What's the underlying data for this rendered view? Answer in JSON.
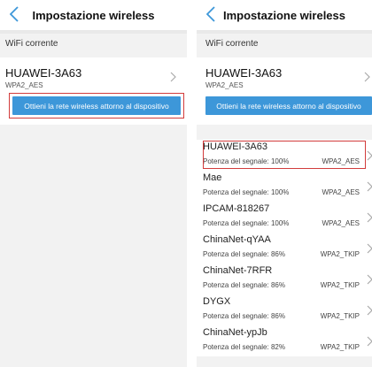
{
  "screen_left": {
    "header": {
      "title": "Impostazione wireless",
      "back_icon": "chevron-left-icon"
    },
    "current_label": "WiFi corrente",
    "current_network": {
      "ssid": "HUAWEI-3A63",
      "security": "WPA2_AES"
    },
    "scan_button_label": "Ottieni la rete wireless attorno al dispositivo"
  },
  "screen_right": {
    "header": {
      "title": "Impostazione wireless",
      "back_icon": "chevron-left-icon"
    },
    "current_label": "WiFi corrente",
    "current_network": {
      "ssid": "HUAWEI-3A63",
      "security": "WPA2_AES"
    },
    "scan_button_label": "Ottieni la rete wireless attorno al dispositivo",
    "networks": [
      {
        "ssid": "HUAWEI-3A63",
        "signal": "Potenza del segnale: 100%",
        "security": "WPA2_AES",
        "highlighted": true
      },
      {
        "ssid": "Mae",
        "signal": "Potenza del segnale: 100%",
        "security": "WPA2_AES"
      },
      {
        "ssid": "IPCAM-818267",
        "signal": "Potenza del segnale: 100%",
        "security": "WPA2_AES"
      },
      {
        "ssid": "ChinaNet-qYAA",
        "signal": "Potenza del segnale: 86%",
        "security": "WPA2_TKIP"
      },
      {
        "ssid": "ChinaNet-7RFR",
        "signal": "Potenza del segnale: 86%",
        "security": "WPA2_TKIP"
      },
      {
        "ssid": "DYGX",
        "signal": "Potenza del segnale: 86%",
        "security": "WPA2_TKIP"
      },
      {
        "ssid": "ChinaNet-ypJb",
        "signal": "Potenza del segnale: 82%",
        "security": "WPA2_TKIP"
      }
    ]
  },
  "colors": {
    "accent": "#3d97d9",
    "highlight_border": "#d23c3c",
    "background": "#f2f2f2"
  }
}
